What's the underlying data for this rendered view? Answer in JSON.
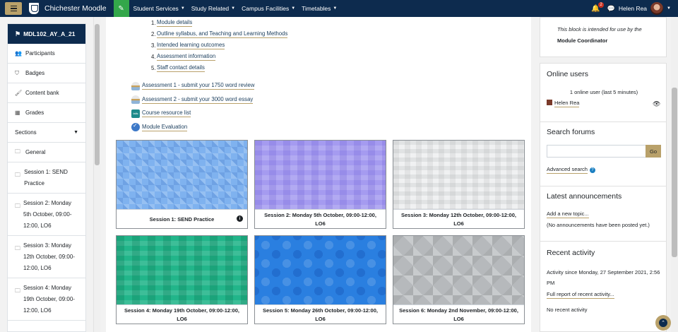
{
  "navbar": {
    "brand": "Chichester Moodle",
    "menus": [
      "Student Services",
      "Study Related",
      "Campus Facilities",
      "Timetables"
    ],
    "notification_count": "2",
    "user_name": "Helen Rea"
  },
  "drawer": {
    "course": "MDL102_AY_A_21",
    "items": [
      "Participants",
      "Badges",
      "Content bank",
      "Grades"
    ],
    "sections_label": "Sections",
    "sections": [
      "General",
      "Session 1: SEND Practice",
      "Session 2: Monday 5th October, 09:00-12:00, LO6",
      "Session 3: Monday 12th October, 09:00-12:00, LO6",
      "Session 4: Monday 19th October, 09:00-12:00, LO6"
    ]
  },
  "outline": [
    {
      "num": "1.",
      "label": "Module details"
    },
    {
      "num": "2.",
      "label": "Outline syllabus, and Teaching and Learning Methods"
    },
    {
      "num": "3.",
      "label": "Intended learning outcomes"
    },
    {
      "num": "4.",
      "label": "Assessment information"
    },
    {
      "num": "5.",
      "label": "Staff contact details"
    }
  ],
  "activities": [
    {
      "label": "Assessment 1 - submit your 1750 word review",
      "icon": "assignment-icon"
    },
    {
      "label": "Assessment 2 - submit your 3000 word essay",
      "icon": "assignment-icon"
    },
    {
      "label": "Course resource list",
      "icon": "talis-icon",
      "icon_text": "talis"
    },
    {
      "label": "Module Evaluation",
      "icon": "feedback-icon"
    }
  ],
  "tiles": [
    "Session 1: SEND Practice",
    "Session 2: Monday 5th October, 09:00-12:00, LO6",
    "Session 3: Monday 12th October, 09:00-12:00, LO6",
    "Session 4: Monday 19th October, 09:00-12:00, LO6",
    "Session 5: Monday 26th October, 09:00-12:00, LO6",
    "Session 6: Monday 2nd November, 09:00-12:00, LO6"
  ],
  "blocks": {
    "coordinator": {
      "line1": "This block is intended for use by the",
      "line2": "Module Coordinator"
    },
    "online_users": {
      "title": "Online users",
      "summary": "1 online user (last 5 minutes)",
      "user": "Helen Rea"
    },
    "search_forums": {
      "title": "Search forums",
      "go": "Go",
      "advanced": "Advanced search"
    },
    "announcements": {
      "title": "Latest announcements",
      "add": "Add a new topic...",
      "none": "(No announcements have been posted yet.)"
    },
    "recent": {
      "title": "Recent activity",
      "since": "Activity since Monday, 27 September 2021, 2:56 PM",
      "full": "Full report of recent activity...",
      "none": "No recent activity"
    }
  },
  "colors": {
    "navbar": "#0d2b4e",
    "accent_gold": "#b9a16a",
    "edit_green": "#33a74a"
  }
}
